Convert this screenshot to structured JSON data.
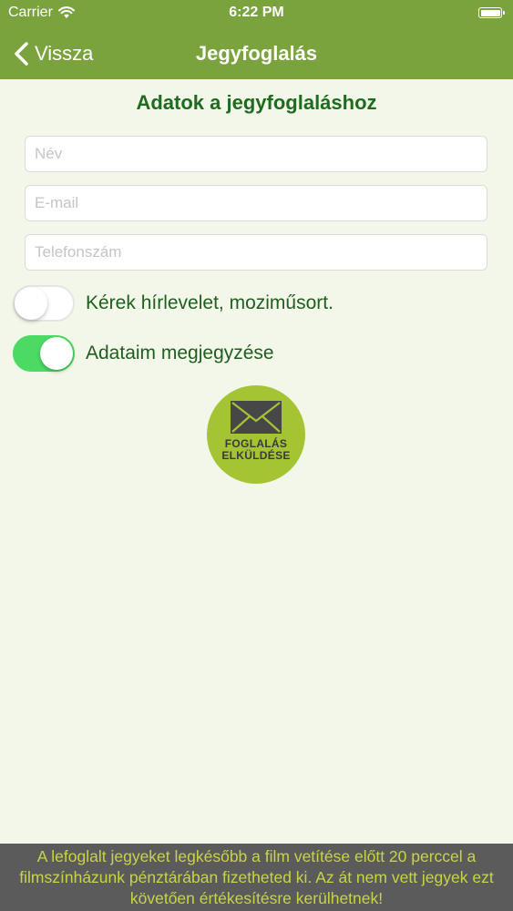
{
  "status_bar": {
    "carrier": "Carrier",
    "time": "6:22 PM"
  },
  "nav": {
    "back_label": "Vissza",
    "title": "Jegyfoglalás"
  },
  "form": {
    "section_title": "Adatok a jegyfoglaláshoz",
    "name_placeholder": "Név",
    "email_placeholder": "E-mail",
    "phone_placeholder": "Telefonszám",
    "name_value": "",
    "email_value": "",
    "phone_value": ""
  },
  "toggles": {
    "newsletter": {
      "label": "Kérek hírlevelet, moziműsort.",
      "state": "off"
    },
    "remember": {
      "label": "Adataim megjegyzése",
      "state": "on"
    }
  },
  "submit": {
    "line1": "FOGLALÁS",
    "line2": "ELKÜLDÉSE",
    "icon": "envelope-icon"
  },
  "footer": {
    "note": "A lefoglalt jegyeket legkésőbb a film vetítése előtt 20 perccel a filmszínházunk pénztárában fizetheted ki. Az át nem vett jegyek ezt követően értékesítésre kerülhetnek!"
  },
  "colors": {
    "accent": "#7aa33d",
    "title_green": "#1f6b1f",
    "toggle_on": "#4cd964",
    "button_green": "#a4c434",
    "footer_bg": "#5b5b5b",
    "footer_text": "#c8d447",
    "background": "#f2f7e9"
  }
}
